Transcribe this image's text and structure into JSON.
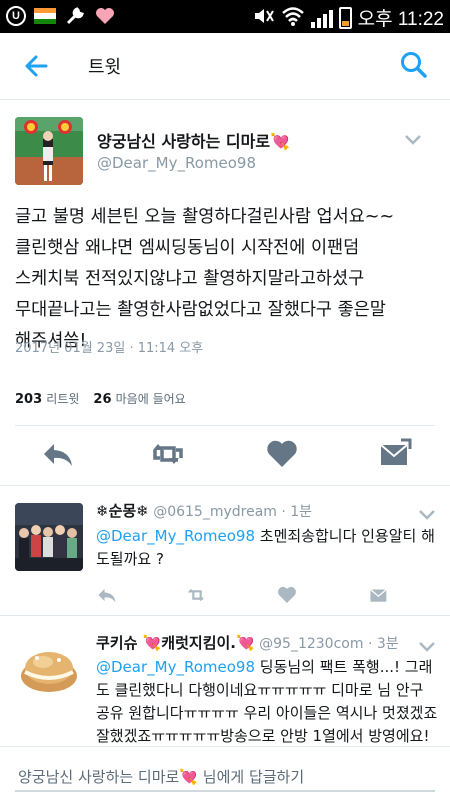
{
  "status_bar": {
    "time": "오후 11:22",
    "icons": [
      "u-plus-icon",
      "flag-icon",
      "wrench-icon",
      "heart-icon",
      "mute-icon",
      "wifi-icon",
      "signal-icon",
      "battery-icon"
    ]
  },
  "app_bar": {
    "title": "트윗",
    "back_icon": "arrow-left-icon",
    "search_icon": "search-icon",
    "accent": "#1da1f2"
  },
  "main_tweet": {
    "display_name": "양궁남신 사랑하는 디마로💘",
    "handle": "@Dear_My_Romeo98",
    "text_lines": [
      "글고 불명 세븐틴 오늘 촬영하다걸린사람 업서요~~",
      "클린햇삼 왜냐면 엠씨딩동님이 시작전에 이팬덤",
      "스케치북 전적있지않냐고 촬영하지말라고하셨구",
      "무대끝나고는 촬영한사람없었다고 잘했다구 좋은말",
      "해주셔씀!"
    ],
    "date": "2017년 01월 23일 · 11:14 오후",
    "retweet_count": "203",
    "retweet_label": "리트윗",
    "like_count": "26",
    "like_label": "마음에 들어요"
  },
  "replies": [
    {
      "display_name": "❄순몽❄",
      "handle": "@0615_mydream",
      "time": "· 1분",
      "mention": "@Dear_My_Romeo98",
      "text": " 초멘죄송합니다 인용알티 해도될까요 ?"
    },
    {
      "display_name": "쿠키슈 💘캐럿지킴이.💘",
      "handle": "@95_1230com",
      "time": "· 3분",
      "mention": "@Dear_My_Romeo98",
      "text": " 딩동님의 팩트 폭행...! 그래도 클린했다니 다행이네요ㅠㅠㅠㅠㅠ 디마로 님 안구 공유 원합니다ㅠㅠㅠㅠ 우리 아이들은 역시나 멋졌겠죠 잘했겠죠ㅠㅠㅠㅠㅠ방송으로 안방 1열에서 방영에요!"
    }
  ],
  "composer": {
    "placeholder": "양궁남신 사랑하는 디마로💘 님에게 답글하기"
  }
}
